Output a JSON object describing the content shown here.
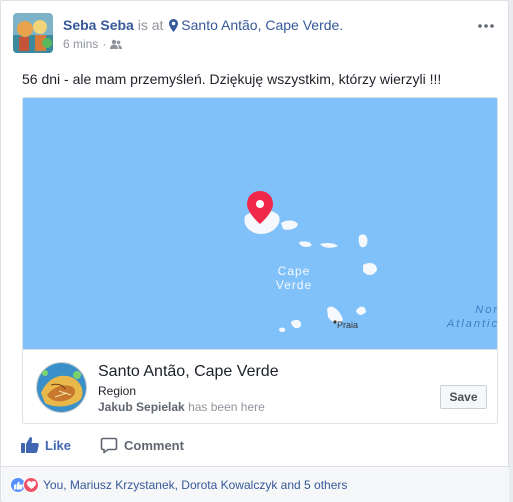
{
  "post": {
    "author": "Seba Seba",
    "is_at": "is at",
    "location": "Santo Antão, Cape Verde.",
    "time": "6 mins",
    "separator": "·",
    "text": "56 dni - ale mam przemyśleń. Dziękuję wszystkim, którzy wierzyli !!!"
  },
  "map": {
    "label_country_line1": "Cape",
    "label_country_line2": "Verde",
    "label_city": "Praia",
    "ocean_line1": "Nor",
    "ocean_line2": "Atlantic",
    "colors": {
      "water": "#81c1f9",
      "land": "#f5f9fd",
      "pin": "#f0284a"
    }
  },
  "place": {
    "title": "Santo Antão, Cape Verde",
    "type": "Region",
    "visitor": "Jakub Sepielak",
    "visited_text": "has been here",
    "save_label": "Save"
  },
  "actions": {
    "like_label": "Like",
    "comment_label": "Comment"
  },
  "reactions": {
    "text": "You, Mariusz Krzystanek, Dorota Kowalczyk and 5 others"
  },
  "colors": {
    "link": "#365899",
    "accent": "#4267b2",
    "muted": "#90949c"
  }
}
